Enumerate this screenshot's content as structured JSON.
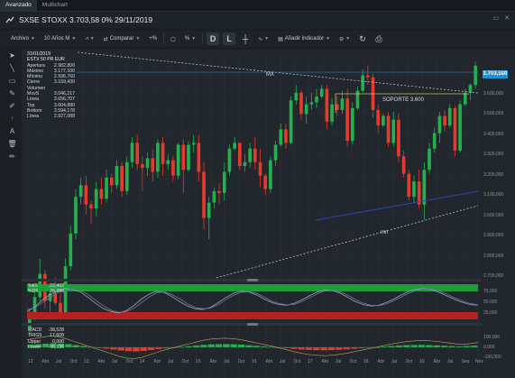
{
  "tabs": [
    {
      "label": "Avanzado",
      "active": true
    },
    {
      "label": "Multichart",
      "active": false
    }
  ],
  "title": "SXSE STOXX 3.703,58 0% 29/11/2019",
  "toolbar": {
    "archivo": "Archivo",
    "period": "10 Años M",
    "comparar": "Comparar",
    "zoom_icon": "+%",
    "pct": "%",
    "d": "D",
    "l": "L",
    "add_indicator": "Añadir indicador"
  },
  "info": {
    "date": "31/01/2019",
    "name": "ESTX 50 PR EUR",
    "rows": [
      {
        "k": "Apertura",
        "v": "2.982,800"
      },
      {
        "k": "Máximo",
        "v": "3.177,100"
      },
      {
        "k": "Mínimo",
        "v": "2.936,760"
      },
      {
        "k": "Cierre",
        "v": "3.159,430"
      },
      {
        "k": "Volumen",
        "v": ""
      },
      {
        "k": "MovS",
        "v": "3.046,217"
      },
      {
        "k": "Línea",
        "v": "3.656,707"
      },
      {
        "k": "Top",
        "v": "3.604,880"
      },
      {
        "k": "Bottom",
        "v": "3.594,178"
      },
      {
        "k": "Línea",
        "v": "2.927,088"
      }
    ]
  },
  "price_tag": "3.703,580",
  "annotations": {
    "mx": "MX",
    "soporte": "SOPORTE 3.600",
    "mn": "mn"
  },
  "y_ticks": [
    "3.700,000",
    "3.600,000",
    "3.500,000",
    "3.400,000",
    "3.300,000",
    "3.200,000",
    "3.100,000",
    "3.000,000",
    "2.900,000",
    "2.800,000",
    "2.700,000"
  ],
  "stoch": {
    "rows": [
      {
        "k": "%K5",
        "v": "22,402"
      },
      {
        "k": "%D5",
        "v": "26,396"
      }
    ],
    "ticks": [
      "75,000",
      "50,000",
      "25,000"
    ]
  },
  "macd": {
    "rows": [
      {
        "k": "MACD",
        "v": "-38,528"
      },
      {
        "k": "TRIG5",
        "v": "17,608"
      },
      {
        "k": "Upper",
        "v": "0,000"
      },
      {
        "k": "Lower",
        "v": "-56,136"
      }
    ],
    "ticks": [
      "100,000",
      "0,000",
      "-100,000"
    ]
  },
  "x_ticks": [
    "12",
    "Abr",
    "Jul",
    "Oct",
    "13",
    "Abr",
    "Jul",
    "Oct",
    "14",
    "Abr",
    "Jul",
    "Oct",
    "15",
    "Abr",
    "Jul",
    "Oct",
    "16",
    "Abr",
    "Jul",
    "Oct",
    "17",
    "Abr",
    "Jul",
    "Oct",
    "18",
    "Abr",
    "Jul",
    "Oct",
    "19",
    "Abr",
    "Jul",
    "Sep",
    "Nov"
  ],
  "colors": {
    "up": "#22b14c",
    "down": "#e53b2c",
    "accent": "#1f8fd6"
  },
  "chart_data": {
    "type": "candlestick",
    "title": "SXSE STOXX",
    "candles": [
      [
        2340,
        2440,
        2300,
        2410
      ],
      [
        2410,
        2550,
        2380,
        2500
      ],
      [
        2500,
        2700,
        2480,
        2620
      ],
      [
        2620,
        2640,
        2440,
        2480
      ],
      [
        2480,
        2560,
        2420,
        2520
      ],
      [
        2520,
        2600,
        2460,
        2470
      ],
      [
        2470,
        2520,
        2380,
        2420
      ],
      [
        2420,
        2700,
        2410,
        2660
      ],
      [
        2660,
        2870,
        2640,
        2830
      ],
      [
        2830,
        3060,
        2800,
        3020
      ],
      [
        3020,
        3120,
        2980,
        3080
      ],
      [
        3080,
        3130,
        2930,
        2980
      ],
      [
        2980,
        3000,
        2880,
        2960
      ],
      [
        2960,
        3100,
        2920,
        3060
      ],
      [
        3060,
        3120,
        2980,
        3010
      ],
      [
        3010,
        3160,
        2990,
        3120
      ],
      [
        3120,
        3140,
        3040,
        3080
      ],
      [
        3080,
        3210,
        3060,
        3180
      ],
      [
        3180,
        3200,
        3020,
        3050
      ],
      [
        3050,
        3230,
        3030,
        3200
      ],
      [
        3200,
        3330,
        3170,
        3300
      ],
      [
        3300,
        3340,
        3160,
        3190
      ],
      [
        3190,
        3230,
        3050,
        3170
      ],
      [
        3170,
        3250,
        3130,
        3220
      ],
      [
        3220,
        3270,
        3100,
        3150
      ],
      [
        3150,
        3320,
        3120,
        3300
      ],
      [
        3300,
        3330,
        3130,
        3190
      ],
      [
        3190,
        3240,
        3160,
        3210
      ],
      [
        3210,
        3230,
        3100,
        3130
      ],
      [
        3130,
        3300,
        3110,
        3290
      ],
      [
        3290,
        3320,
        3040,
        3160
      ],
      [
        3160,
        3310,
        3150,
        3290
      ],
      [
        3290,
        3340,
        3250,
        3300
      ],
      [
        3300,
        3340,
        3100,
        3150
      ],
      [
        3150,
        3200,
        2850,
        2910
      ],
      [
        2910,
        3020,
        2800,
        2990
      ],
      [
        2990,
        3070,
        2960,
        3050
      ],
      [
        3050,
        3090,
        2980,
        3040
      ],
      [
        3040,
        3200,
        3000,
        3150
      ],
      [
        3150,
        3290,
        3130,
        3270
      ],
      [
        3270,
        3330,
        3260,
        3300
      ],
      [
        3300,
        3290,
        3160,
        3180
      ],
      [
        3180,
        3240,
        3150,
        3200
      ],
      [
        3200,
        3300,
        3170,
        3270
      ],
      [
        3270,
        3330,
        3160,
        3200
      ],
      [
        3200,
        3270,
        3070,
        3130
      ],
      [
        3130,
        3140,
        3030,
        3060
      ],
      [
        3060,
        3230,
        3040,
        3210
      ],
      [
        3210,
        3310,
        3180,
        3290
      ],
      [
        3290,
        3400,
        3280,
        3370
      ],
      [
        3370,
        3400,
        3270,
        3300
      ],
      [
        3300,
        3540,
        3290,
        3520
      ],
      [
        3520,
        3600,
        3500,
        3560
      ],
      [
        3560,
        3570,
        3420,
        3450
      ],
      [
        3450,
        3540,
        3400,
        3500
      ],
      [
        3500,
        3560,
        3470,
        3510
      ],
      [
        3510,
        3580,
        3480,
        3540
      ],
      [
        3540,
        3600,
        3530,
        3580
      ],
      [
        3580,
        3600,
        3370,
        3410
      ],
      [
        3410,
        3530,
        3390,
        3500
      ],
      [
        3500,
        3540,
        3440,
        3470
      ],
      [
        3470,
        3570,
        3450,
        3530
      ],
      [
        3530,
        3580,
        3280,
        3310
      ],
      [
        3310,
        3510,
        3290,
        3480
      ],
      [
        3480,
        3590,
        3470,
        3570
      ],
      [
        3570,
        3680,
        3560,
        3650
      ],
      [
        3650,
        3700,
        3600,
        3640
      ],
      [
        3640,
        3660,
        3430,
        3470
      ],
      [
        3470,
        3500,
        3350,
        3390
      ],
      [
        3390,
        3450,
        3380,
        3440
      ],
      [
        3440,
        3460,
        3280,
        3300
      ],
      [
        3300,
        3460,
        3280,
        3420
      ],
      [
        3420,
        3450,
        3200,
        3230
      ],
      [
        3230,
        3260,
        3120,
        3140
      ],
      [
        3140,
        3160,
        3000,
        3020
      ],
      [
        3020,
        3130,
        2990,
        3100
      ],
      [
        3100,
        3160,
        2960,
        2980
      ],
      [
        2980,
        3200,
        2900,
        3160
      ],
      [
        3160,
        3300,
        3140,
        3270
      ],
      [
        3270,
        3380,
        3250,
        3350
      ],
      [
        3350,
        3460,
        3300,
        3440
      ],
      [
        3440,
        3470,
        3360,
        3390
      ],
      [
        3390,
        3500,
        3380,
        3480
      ],
      [
        3480,
        3490,
        3230,
        3260
      ],
      [
        3260,
        3520,
        3250,
        3500
      ],
      [
        3500,
        3580,
        3490,
        3560
      ],
      [
        3560,
        3610,
        3520,
        3600
      ],
      [
        3600,
        3720,
        3580,
        3700
      ]
    ],
    "ylim": [
      2600,
      3760
    ],
    "stoch_k": [
      22,
      35,
      55,
      70,
      82,
      88,
      85,
      78,
      62,
      45,
      30,
      22,
      18,
      25,
      40,
      58,
      72,
      80,
      76,
      64,
      50,
      38,
      30,
      28,
      34,
      48,
      62,
      74,
      80,
      78,
      70,
      58,
      48,
      42,
      40,
      46,
      56,
      68,
      78,
      84,
      82,
      74,
      62,
      50,
      42,
      38,
      40,
      48,
      58,
      70,
      80,
      86,
      88,
      84,
      76,
      66,
      56,
      48,
      42,
      40
    ],
    "stoch_d": [
      28,
      32,
      48,
      62,
      76,
      84,
      86,
      82,
      70,
      54,
      38,
      26,
      20,
      22,
      32,
      48,
      64,
      76,
      78,
      70,
      58,
      44,
      34,
      30,
      32,
      42,
      56,
      68,
      77,
      79,
      74,
      64,
      52,
      45,
      41,
      43,
      51,
      62,
      73,
      81,
      83,
      78,
      68,
      56,
      46,
      40,
      39,
      44,
      53,
      64,
      75,
      83,
      87,
      86,
      80,
      71,
      61,
      52,
      45,
      41
    ],
    "macd_hist": [
      60,
      70,
      80,
      90,
      85,
      70,
      50,
      30,
      10,
      -10,
      -30,
      -50,
      -70,
      -85,
      -90,
      -80,
      -60,
      -40,
      -20,
      -5,
      10,
      25,
      40,
      55,
      65,
      70,
      72,
      68,
      60,
      48,
      35,
      22,
      10,
      -5,
      -20,
      -35,
      -48,
      -58,
      -64,
      -66,
      -62,
      -55,
      -45,
      -32,
      -20,
      -8,
      5,
      18,
      30,
      40,
      48,
      52,
      54,
      50,
      44,
      36,
      28,
      22,
      30,
      38
    ]
  }
}
